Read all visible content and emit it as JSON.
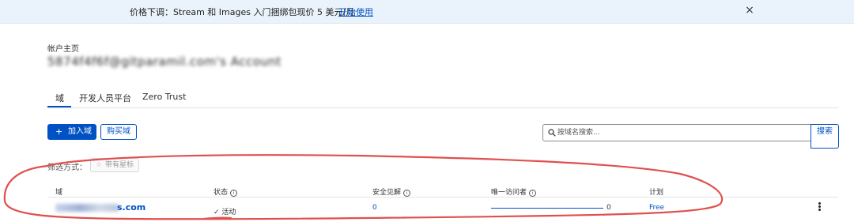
{
  "banner": {
    "text": "价格下调：Stream 和 Images 入门捆绑包现价 5 美元/月",
    "link": "开始使用",
    "close_glyph": "×"
  },
  "account": {
    "label": "帐户主页",
    "email_redacted": "5874f4f6f@gitparamil.com's Account"
  },
  "tabs": [
    {
      "label": "域",
      "active": true
    },
    {
      "label": "开发人员平台",
      "active": false
    },
    {
      "label": "Zero Trust",
      "active": false
    }
  ],
  "toolbar": {
    "add_label": "加入域",
    "add_icon": "+",
    "buy_label": "购买域",
    "search_placeholder": "按域名搜索...",
    "search_button": "搜索"
  },
  "filter": {
    "label": "筛选方式：",
    "chip_label": "带有星标",
    "chip_icon": "☆"
  },
  "table": {
    "headers": {
      "domain": "域",
      "status": "状态",
      "security": "安全见解",
      "visitors": "唯一访问者",
      "plan": "计划"
    },
    "rows": [
      {
        "domain_suffix": "s.com",
        "status_icon": "✓",
        "status": "活动",
        "security": "0",
        "visitors": "0",
        "plan": "Free"
      }
    ]
  },
  "colors": {
    "accent": "#0051c3",
    "banner_bg": "#eaf3fb",
    "annotation": "#e0504e"
  }
}
